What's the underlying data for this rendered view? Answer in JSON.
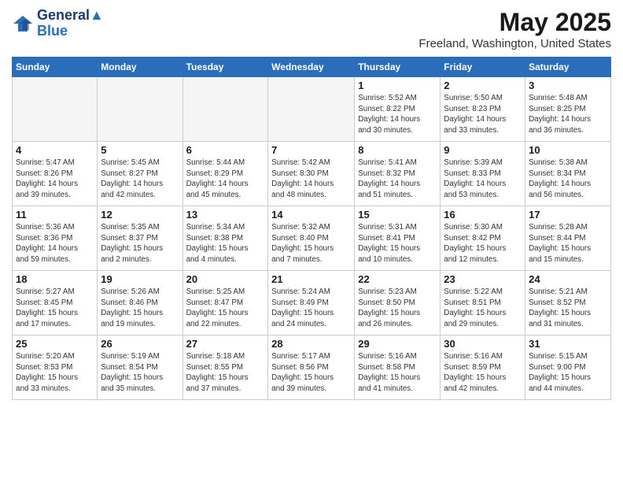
{
  "header": {
    "logo_line1": "General",
    "logo_line2": "Blue",
    "month_title": "May 2025",
    "subtitle": "Freeland, Washington, United States"
  },
  "days_of_week": [
    "Sunday",
    "Monday",
    "Tuesday",
    "Wednesday",
    "Thursday",
    "Friday",
    "Saturday"
  ],
  "weeks": [
    [
      {
        "day": "",
        "info": ""
      },
      {
        "day": "",
        "info": ""
      },
      {
        "day": "",
        "info": ""
      },
      {
        "day": "",
        "info": ""
      },
      {
        "day": "1",
        "info": "Sunrise: 5:52 AM\nSunset: 8:22 PM\nDaylight: 14 hours\nand 30 minutes."
      },
      {
        "day": "2",
        "info": "Sunrise: 5:50 AM\nSunset: 8:23 PM\nDaylight: 14 hours\nand 33 minutes."
      },
      {
        "day": "3",
        "info": "Sunrise: 5:48 AM\nSunset: 8:25 PM\nDaylight: 14 hours\nand 36 minutes."
      }
    ],
    [
      {
        "day": "4",
        "info": "Sunrise: 5:47 AM\nSunset: 8:26 PM\nDaylight: 14 hours\nand 39 minutes."
      },
      {
        "day": "5",
        "info": "Sunrise: 5:45 AM\nSunset: 8:27 PM\nDaylight: 14 hours\nand 42 minutes."
      },
      {
        "day": "6",
        "info": "Sunrise: 5:44 AM\nSunset: 8:29 PM\nDaylight: 14 hours\nand 45 minutes."
      },
      {
        "day": "7",
        "info": "Sunrise: 5:42 AM\nSunset: 8:30 PM\nDaylight: 14 hours\nand 48 minutes."
      },
      {
        "day": "8",
        "info": "Sunrise: 5:41 AM\nSunset: 8:32 PM\nDaylight: 14 hours\nand 51 minutes."
      },
      {
        "day": "9",
        "info": "Sunrise: 5:39 AM\nSunset: 8:33 PM\nDaylight: 14 hours\nand 53 minutes."
      },
      {
        "day": "10",
        "info": "Sunrise: 5:38 AM\nSunset: 8:34 PM\nDaylight: 14 hours\nand 56 minutes."
      }
    ],
    [
      {
        "day": "11",
        "info": "Sunrise: 5:36 AM\nSunset: 8:36 PM\nDaylight: 14 hours\nand 59 minutes."
      },
      {
        "day": "12",
        "info": "Sunrise: 5:35 AM\nSunset: 8:37 PM\nDaylight: 15 hours\nand 2 minutes."
      },
      {
        "day": "13",
        "info": "Sunrise: 5:34 AM\nSunset: 8:38 PM\nDaylight: 15 hours\nand 4 minutes."
      },
      {
        "day": "14",
        "info": "Sunrise: 5:32 AM\nSunset: 8:40 PM\nDaylight: 15 hours\nand 7 minutes."
      },
      {
        "day": "15",
        "info": "Sunrise: 5:31 AM\nSunset: 8:41 PM\nDaylight: 15 hours\nand 10 minutes."
      },
      {
        "day": "16",
        "info": "Sunrise: 5:30 AM\nSunset: 8:42 PM\nDaylight: 15 hours\nand 12 minutes."
      },
      {
        "day": "17",
        "info": "Sunrise: 5:28 AM\nSunset: 8:44 PM\nDaylight: 15 hours\nand 15 minutes."
      }
    ],
    [
      {
        "day": "18",
        "info": "Sunrise: 5:27 AM\nSunset: 8:45 PM\nDaylight: 15 hours\nand 17 minutes."
      },
      {
        "day": "19",
        "info": "Sunrise: 5:26 AM\nSunset: 8:46 PM\nDaylight: 15 hours\nand 19 minutes."
      },
      {
        "day": "20",
        "info": "Sunrise: 5:25 AM\nSunset: 8:47 PM\nDaylight: 15 hours\nand 22 minutes."
      },
      {
        "day": "21",
        "info": "Sunrise: 5:24 AM\nSunset: 8:49 PM\nDaylight: 15 hours\nand 24 minutes."
      },
      {
        "day": "22",
        "info": "Sunrise: 5:23 AM\nSunset: 8:50 PM\nDaylight: 15 hours\nand 26 minutes."
      },
      {
        "day": "23",
        "info": "Sunrise: 5:22 AM\nSunset: 8:51 PM\nDaylight: 15 hours\nand 29 minutes."
      },
      {
        "day": "24",
        "info": "Sunrise: 5:21 AM\nSunset: 8:52 PM\nDaylight: 15 hours\nand 31 minutes."
      }
    ],
    [
      {
        "day": "25",
        "info": "Sunrise: 5:20 AM\nSunset: 8:53 PM\nDaylight: 15 hours\nand 33 minutes."
      },
      {
        "day": "26",
        "info": "Sunrise: 5:19 AM\nSunset: 8:54 PM\nDaylight: 15 hours\nand 35 minutes."
      },
      {
        "day": "27",
        "info": "Sunrise: 5:18 AM\nSunset: 8:55 PM\nDaylight: 15 hours\nand 37 minutes."
      },
      {
        "day": "28",
        "info": "Sunrise: 5:17 AM\nSunset: 8:56 PM\nDaylight: 15 hours\nand 39 minutes."
      },
      {
        "day": "29",
        "info": "Sunrise: 5:16 AM\nSunset: 8:58 PM\nDaylight: 15 hours\nand 41 minutes."
      },
      {
        "day": "30",
        "info": "Sunrise: 5:16 AM\nSunset: 8:59 PM\nDaylight: 15 hours\nand 42 minutes."
      },
      {
        "day": "31",
        "info": "Sunrise: 5:15 AM\nSunset: 9:00 PM\nDaylight: 15 hours\nand 44 minutes."
      }
    ]
  ]
}
